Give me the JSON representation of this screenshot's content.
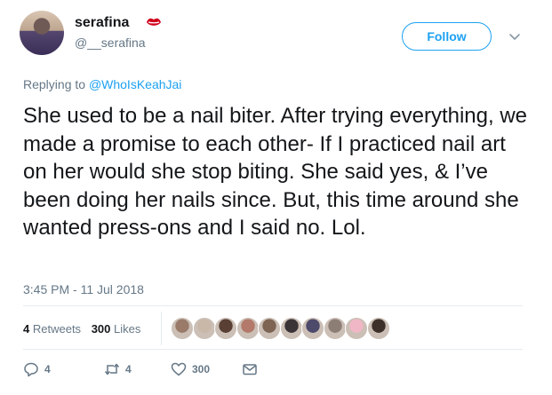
{
  "user": {
    "display_name": "serafina",
    "handle": "@__serafina",
    "emoji": "lips-icon"
  },
  "follow_label": "Follow",
  "replying": {
    "prefix": "Replying to ",
    "target": "@WhoIsKeahJai"
  },
  "tweet_text": "She used to be a nail biter. After trying everything, we made a promise to each other- If I practiced nail art on her would she stop biting. She said yes, & I’ve been doing her nails since. But, this time around she wanted press-ons and I said no. Lol.",
  "timestamp": "3:45 PM - 11 Jul 2018",
  "stats": {
    "retweets_count": "4",
    "retweets_label": "Retweets",
    "likes_count": "300",
    "likes_label": "Likes"
  },
  "liker_colors": [
    "#9a7b6a",
    "#c9b7a8",
    "#5a3f35",
    "#b3796a",
    "#7d6453",
    "#3b3436",
    "#4e4a6b",
    "#8c7d75",
    "#f0b7c6",
    "#3d2f2a"
  ],
  "actions": {
    "reply_count": "4",
    "retweet_count": "4",
    "like_count": "300"
  },
  "colors": {
    "accent": "#1da1f2",
    "muted": "#657786",
    "text": "#14171a"
  }
}
